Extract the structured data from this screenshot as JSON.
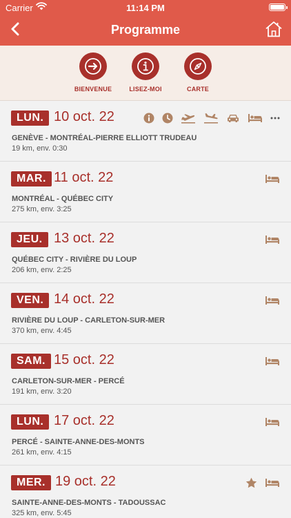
{
  "status": {
    "carrier": "Carrier",
    "time": "11:14 PM"
  },
  "nav": {
    "title": "Programme",
    "back_icon": "chevron-left-icon",
    "home_icon": "home-icon"
  },
  "quick": [
    {
      "label": "BIENVENUE",
      "icon": "arrow-right-icon"
    },
    {
      "label": "LISEZ-MOI",
      "icon": "info-icon"
    },
    {
      "label": "CARTE",
      "icon": "compass-icon"
    }
  ],
  "days": [
    {
      "day": "LUN.",
      "date": "10 oct. 22",
      "route": "GENÈVE - MONTRÉAL-PIERRE ELLIOTT TRUDEAU",
      "dist": "19 km, env. 0:30",
      "icons": [
        "info",
        "clock",
        "plane-departure",
        "plane-arrival",
        "car",
        "bed",
        "more"
      ]
    },
    {
      "day": "MAR.",
      "date": "11 oct. 22",
      "route": "MONTRÉAL - QUÉBEC CITY",
      "dist": "275 km, env. 3:25",
      "icons": [
        "bed"
      ]
    },
    {
      "day": "JEU.",
      "date": "13 oct. 22",
      "route": "QUÉBEC CITY - RIVIÈRE DU LOUP",
      "dist": "206 km, env. 2:25",
      "icons": [
        "bed"
      ]
    },
    {
      "day": "VEN.",
      "date": "14 oct. 22",
      "route": "RIVIÈRE DU LOUP - CARLETON-SUR-MER",
      "dist": "370 km, env. 4:45",
      "icons": [
        "bed"
      ]
    },
    {
      "day": "SAM.",
      "date": "15 oct. 22",
      "route": "CARLETON-SUR-MER - PERCÉ",
      "dist": "191 km, env. 3:20",
      "icons": [
        "bed"
      ]
    },
    {
      "day": "LUN.",
      "date": "17 oct. 22",
      "route": "PERCÉ - SAINTE-ANNE-DES-MONTS",
      "dist": "261 km, env. 4:15",
      "icons": [
        "bed"
      ]
    },
    {
      "day": "MER.",
      "date": "19 oct. 22",
      "route": "SAINTE-ANNE-DES-MONTS - TADOUSSAC",
      "dist": "325 km, env. 5:45",
      "icons": [
        "star",
        "bed"
      ]
    }
  ],
  "colors": {
    "brand": "#e05a4a",
    "accent": "#a8302b",
    "icon": "#b08566"
  }
}
